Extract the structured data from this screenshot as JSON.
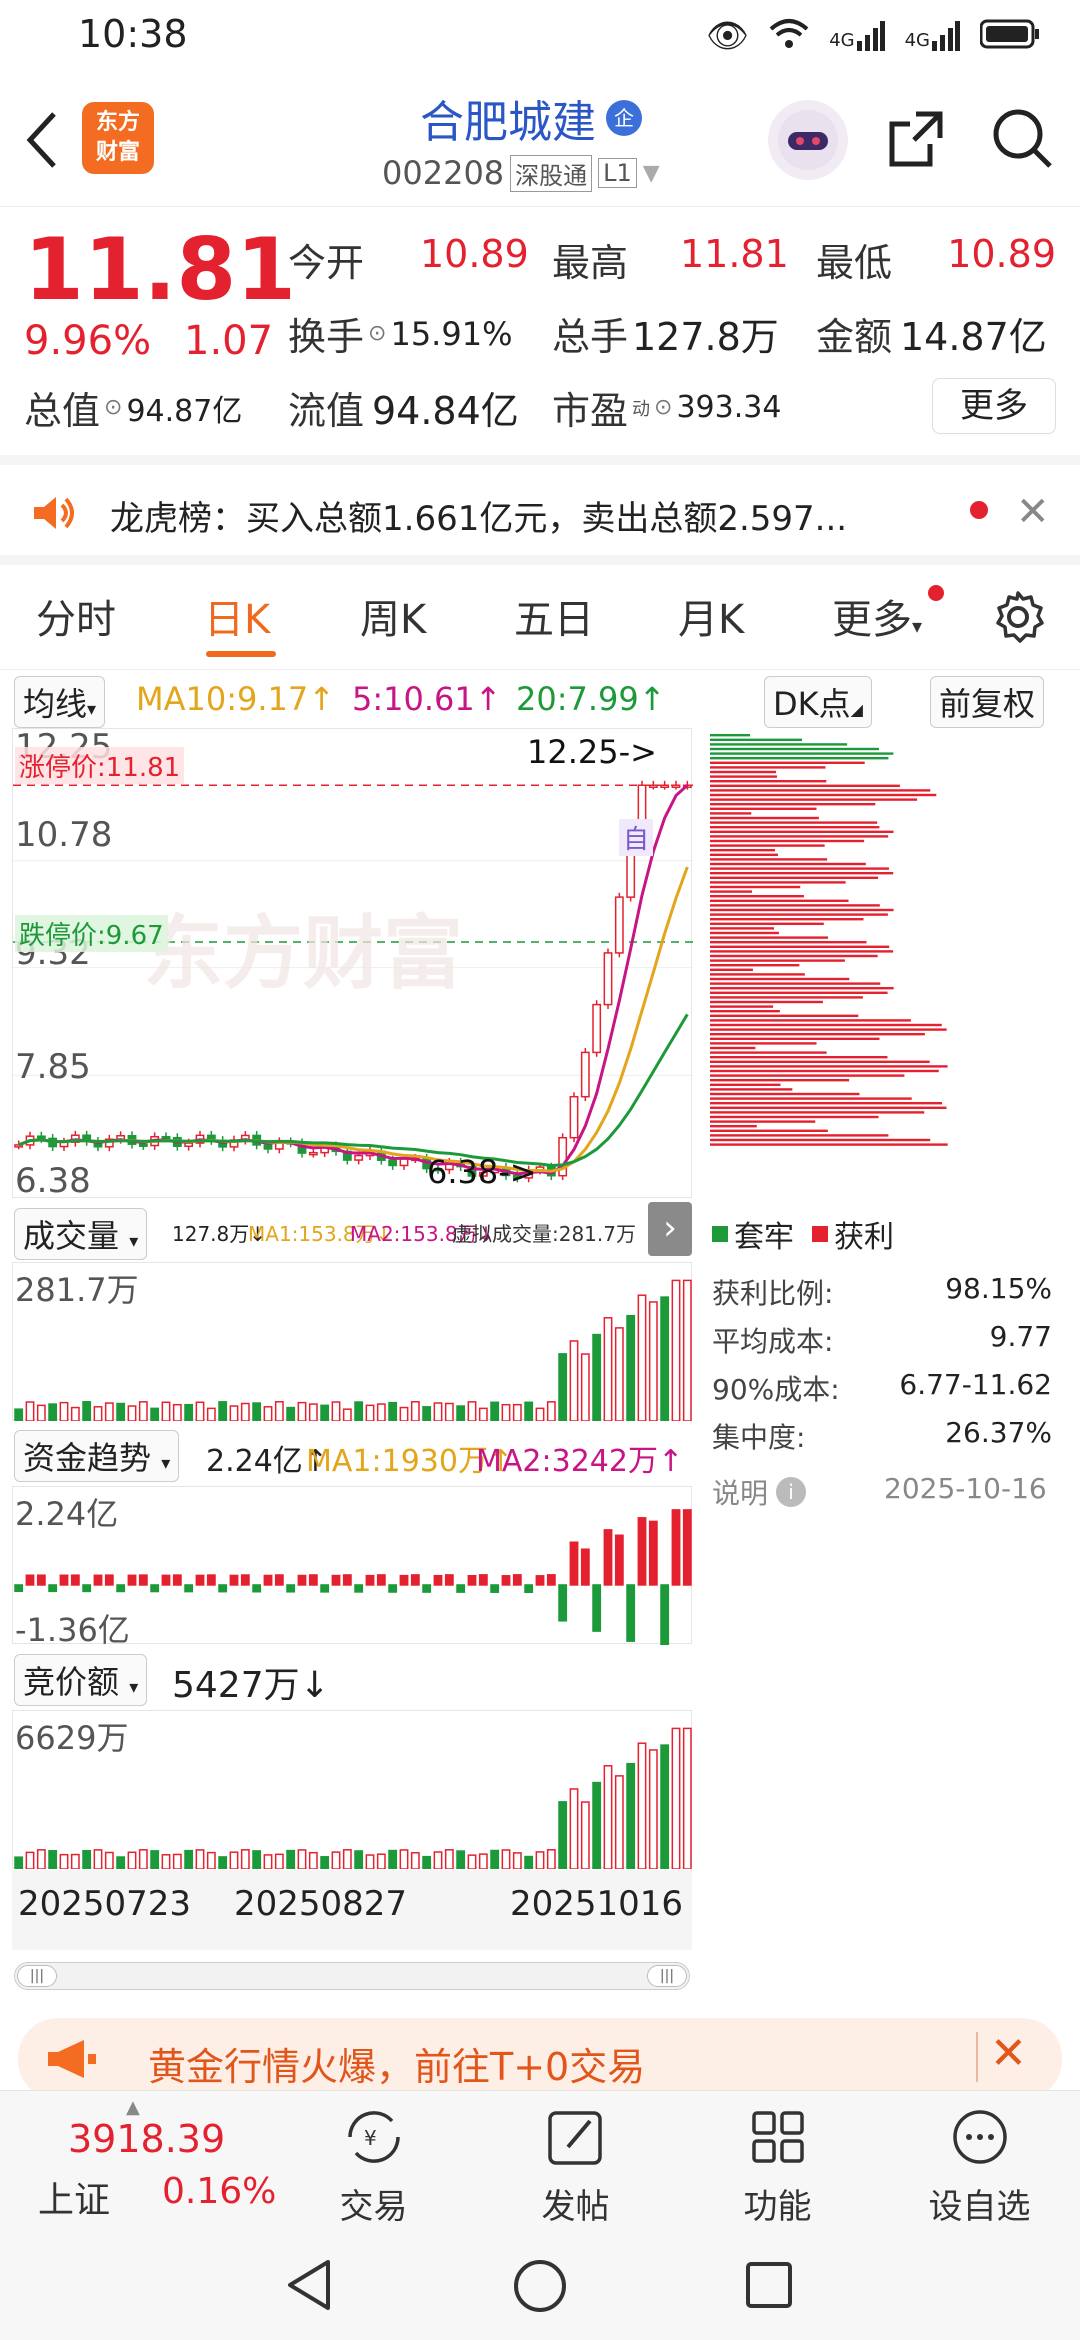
{
  "status": {
    "time": "10:38",
    "signal1": "4G",
    "signal2": "4G"
  },
  "header": {
    "back_icon": "back-arrow-icon",
    "logo_text_top": "东方",
    "logo_text_bottom": "财富",
    "title": "合肥城建",
    "title_badge": "企",
    "code": "002208",
    "tag_sgt": "深股通",
    "tag_level": "L1",
    "share_icon": "share-icon",
    "search_icon": "search-icon"
  },
  "quote": {
    "price": "11.81",
    "change_pct": "9.96%",
    "change": "1.07",
    "open_label": "今开",
    "open": "10.89",
    "high_label": "最高",
    "high": "11.81",
    "low_label": "最低",
    "low": "10.89",
    "turnover_label": "换手",
    "turnover": "15.91%",
    "volume_label": "总手",
    "volume": "127.8万",
    "amount_label": "金额",
    "amount": "14.87亿",
    "mktcap_label": "总值",
    "mktcap": "94.87亿",
    "float_label": "流值",
    "float": "94.84亿",
    "pe_label": "市盈",
    "pe_sup": "动",
    "pe": "393.34",
    "more": "更多"
  },
  "banner": {
    "text": "龙虎榜：买入总额1.661亿元，卖出总额2.597..."
  },
  "tabs": [
    "分时",
    "日K",
    "周K",
    "五日",
    "月K",
    "更多"
  ],
  "active_tab": 1,
  "ma": {
    "label": "均线",
    "ma10": "MA10:9.17↑",
    "ma5": "5:10.61↑",
    "ma20": "20:7.99↑",
    "dk": "DK点",
    "adjust": "前复权"
  },
  "kline": {
    "y_top": "12.25",
    "y_2": "10.78",
    "y_3": "9.32",
    "y_4": "7.85",
    "y_bottom": "6.38",
    "limit_up": "涨停价:11.81",
    "limit_down": "跌停价:9.67",
    "max_marker": "12.25->",
    "min_marker": "6.38->",
    "watermark": "东方财富",
    "self_tag": "自"
  },
  "chart_data": {
    "type": "candlestick",
    "series_hint": "daily K-line, price range 6.38–12.25, with MA5/MA10/MA20",
    "ylim": [
      6.38,
      12.25
    ],
    "ticks": [
      "12.25",
      "10.78",
      "9.32",
      "7.85",
      "6.38"
    ],
    "limit_up": 11.81,
    "limit_down": 9.67
  },
  "volume": {
    "label": "成交量",
    "v": "127.8万↓",
    "ma1": "MA1:153.8万↓",
    "ma2": "MA2:153.8万↓",
    "virtual": "虚拟成交量:281.7万",
    "max": "281.7万"
  },
  "capital": {
    "label": "资金趋势",
    "v": "2.24亿↑",
    "ma1": "MA1:1930万↑",
    "ma2": "MA2:3242万↑",
    "max": "2.24亿",
    "min": "-1.36亿"
  },
  "auction": {
    "label": "竞价额",
    "v": "5427万↓",
    "max": "6629万"
  },
  "dates": [
    "20250723",
    "20250827",
    "20251016"
  ],
  "chip": {
    "legend_loss": "套牢",
    "legend_profit": "获利",
    "rows": [
      {
        "label": "获利比例:",
        "value": "98.15%"
      },
      {
        "label": "平均成本:",
        "value": "9.77"
      },
      {
        "label": "90%成本:",
        "value": "6.77-11.62"
      },
      {
        "label": "集中度:",
        "value": "26.37%"
      }
    ],
    "note": "说明",
    "date": "2025-10-16"
  },
  "gold_banner": {
    "text": "黄金行情火爆，前往T+0交易"
  },
  "bottom": {
    "index_value": "3918.39",
    "index_name": "上证",
    "index_pct": "0.16%",
    "items": [
      "交易",
      "发帖",
      "功能",
      "设自选"
    ]
  },
  "colors": {
    "up": "#e4212f",
    "down": "#1c9a3a",
    "accent": "#f06a1d",
    "brand_blue": "#2a56c6"
  }
}
